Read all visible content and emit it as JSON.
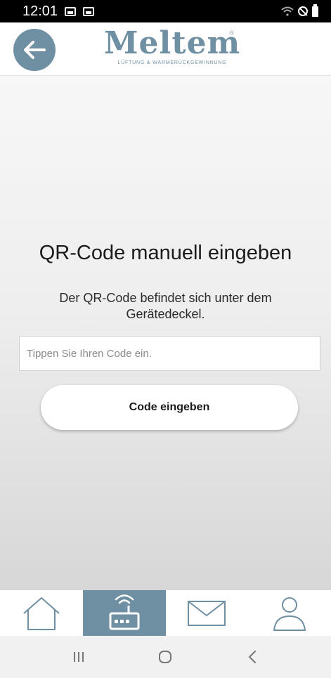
{
  "status_bar": {
    "time": "12:01"
  },
  "header": {
    "logo_text": "Meltem",
    "logo_registered": "®",
    "logo_tagline": "LÜFTUNG & WÄRMERÜCKGEWINNUNG",
    "brand_color": "#6f8fa3"
  },
  "main": {
    "title": "QR-Code manuell eingeben",
    "subtitle": "Der QR-Code befindet sich unter dem Gerätedeckel.",
    "input": {
      "placeholder": "Tippen Sie Ihren Code ein.",
      "value": ""
    },
    "submit_label": "Code eingeben"
  },
  "tab_bar": {
    "tabs": [
      {
        "icon": "home-icon",
        "active": false
      },
      {
        "icon": "device-icon",
        "active": true
      },
      {
        "icon": "mail-icon",
        "active": false
      },
      {
        "icon": "user-icon",
        "active": false
      }
    ]
  },
  "nav_bar": {
    "buttons": [
      "recent-apps-icon",
      "home-circle-icon",
      "back-chevron-icon"
    ]
  }
}
